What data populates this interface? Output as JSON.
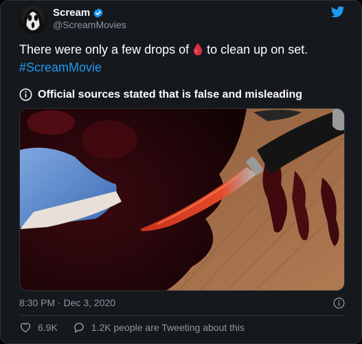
{
  "author": {
    "display_name": "Scream",
    "handle": "@ScreamMovies",
    "verified": true
  },
  "tweet": {
    "text_before": "There were only a few drops of",
    "emoji": "drop-of-blood-icon",
    "text_after": "to clean up on set.",
    "hashtag": "#ScreamMovie"
  },
  "warning": {
    "text": "Official sources stated that is false and misleading"
  },
  "meta": {
    "timestamp": "8:30 PM · Dec 3, 2020"
  },
  "actions": {
    "likes": "6.9K",
    "replies": "1.2K people are Tweeting about this"
  },
  "colors": {
    "background": "#15181c",
    "link": "#1d9bf0",
    "verified": "#1d9bf0",
    "twitter_bird": "#1d9bf0",
    "muted": "#8b98a5",
    "blood": "#dd2e44"
  }
}
